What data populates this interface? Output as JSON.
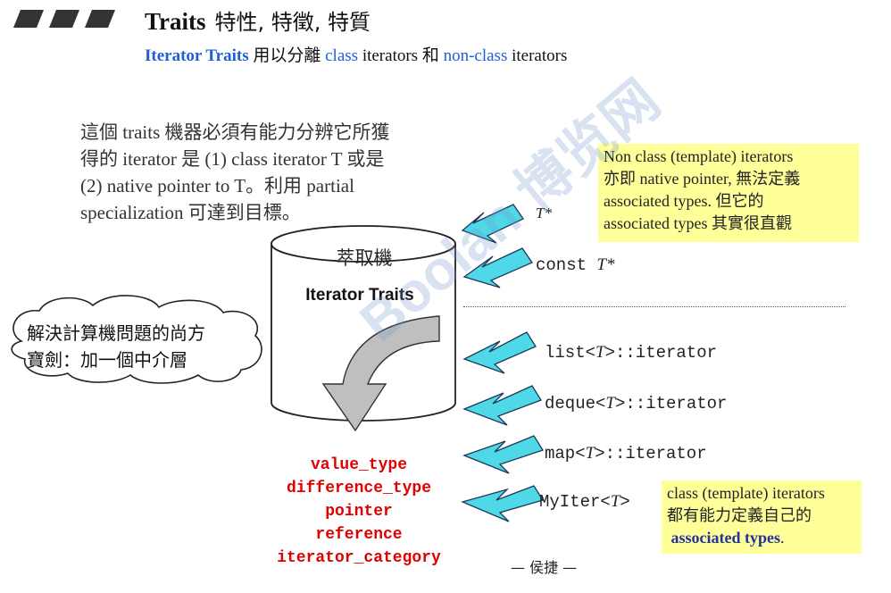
{
  "title": {
    "main": "Traits",
    "cjk": "特性, 特徵, 特質"
  },
  "subtitle": {
    "part1": "Iterator Traits",
    "part2": " 用以分離 ",
    "part3": "class",
    "part4": " iterators 和 ",
    "part5": "non-class",
    "part6": " iterators"
  },
  "paragraph": {
    "line1": "這個 traits 機器必須有能力分辨它所獲",
    "line2": "得的 iterator 是 (1) class iterator T 或是",
    "line3": "(2) native pointer to T。利用 partial",
    "line4": "specialization 可達到目標。"
  },
  "note_nonclass": {
    "line1": "Non class (template) iterators",
    "line2": "亦即 native pointer, 無法定義",
    "line3": "associated types. 但它的",
    "line4": "associated types 其實很直觀"
  },
  "note_class": {
    "line1": "class (template) iterators",
    "line2": "都有能力定義自己的",
    "line3": "associated types",
    "line3_end": "."
  },
  "cylinder": {
    "top_label": "萃取機",
    "label": "Iterator Traits"
  },
  "cloud": {
    "line1": "解決計算機問題的尚方",
    "line2": "寶劍：加一個中介層"
  },
  "iterators": {
    "pointer_T": "T*",
    "const_prefix": "const ",
    "const_T": "T*",
    "list_pre": "list<",
    "list_post": ">::iterator",
    "deque_pre": "deque<",
    "deque_post": ">::iterator",
    "map_pre": "map<",
    "map_post": ">::iterator",
    "myiter_pre": "MyIter<",
    "myiter_post": ">",
    "T": "T"
  },
  "associated_types": [
    "value_type",
    "difference_type",
    "pointer",
    "reference",
    "iterator_category"
  ],
  "author": "— 侯捷 —",
  "watermark": "Boolan 博览网",
  "colors": {
    "arrow_fill": "#4ed8e8",
    "note_bg": "#ffff99",
    "red_text": "#e00000",
    "blue_text": "#1f5fd6"
  }
}
